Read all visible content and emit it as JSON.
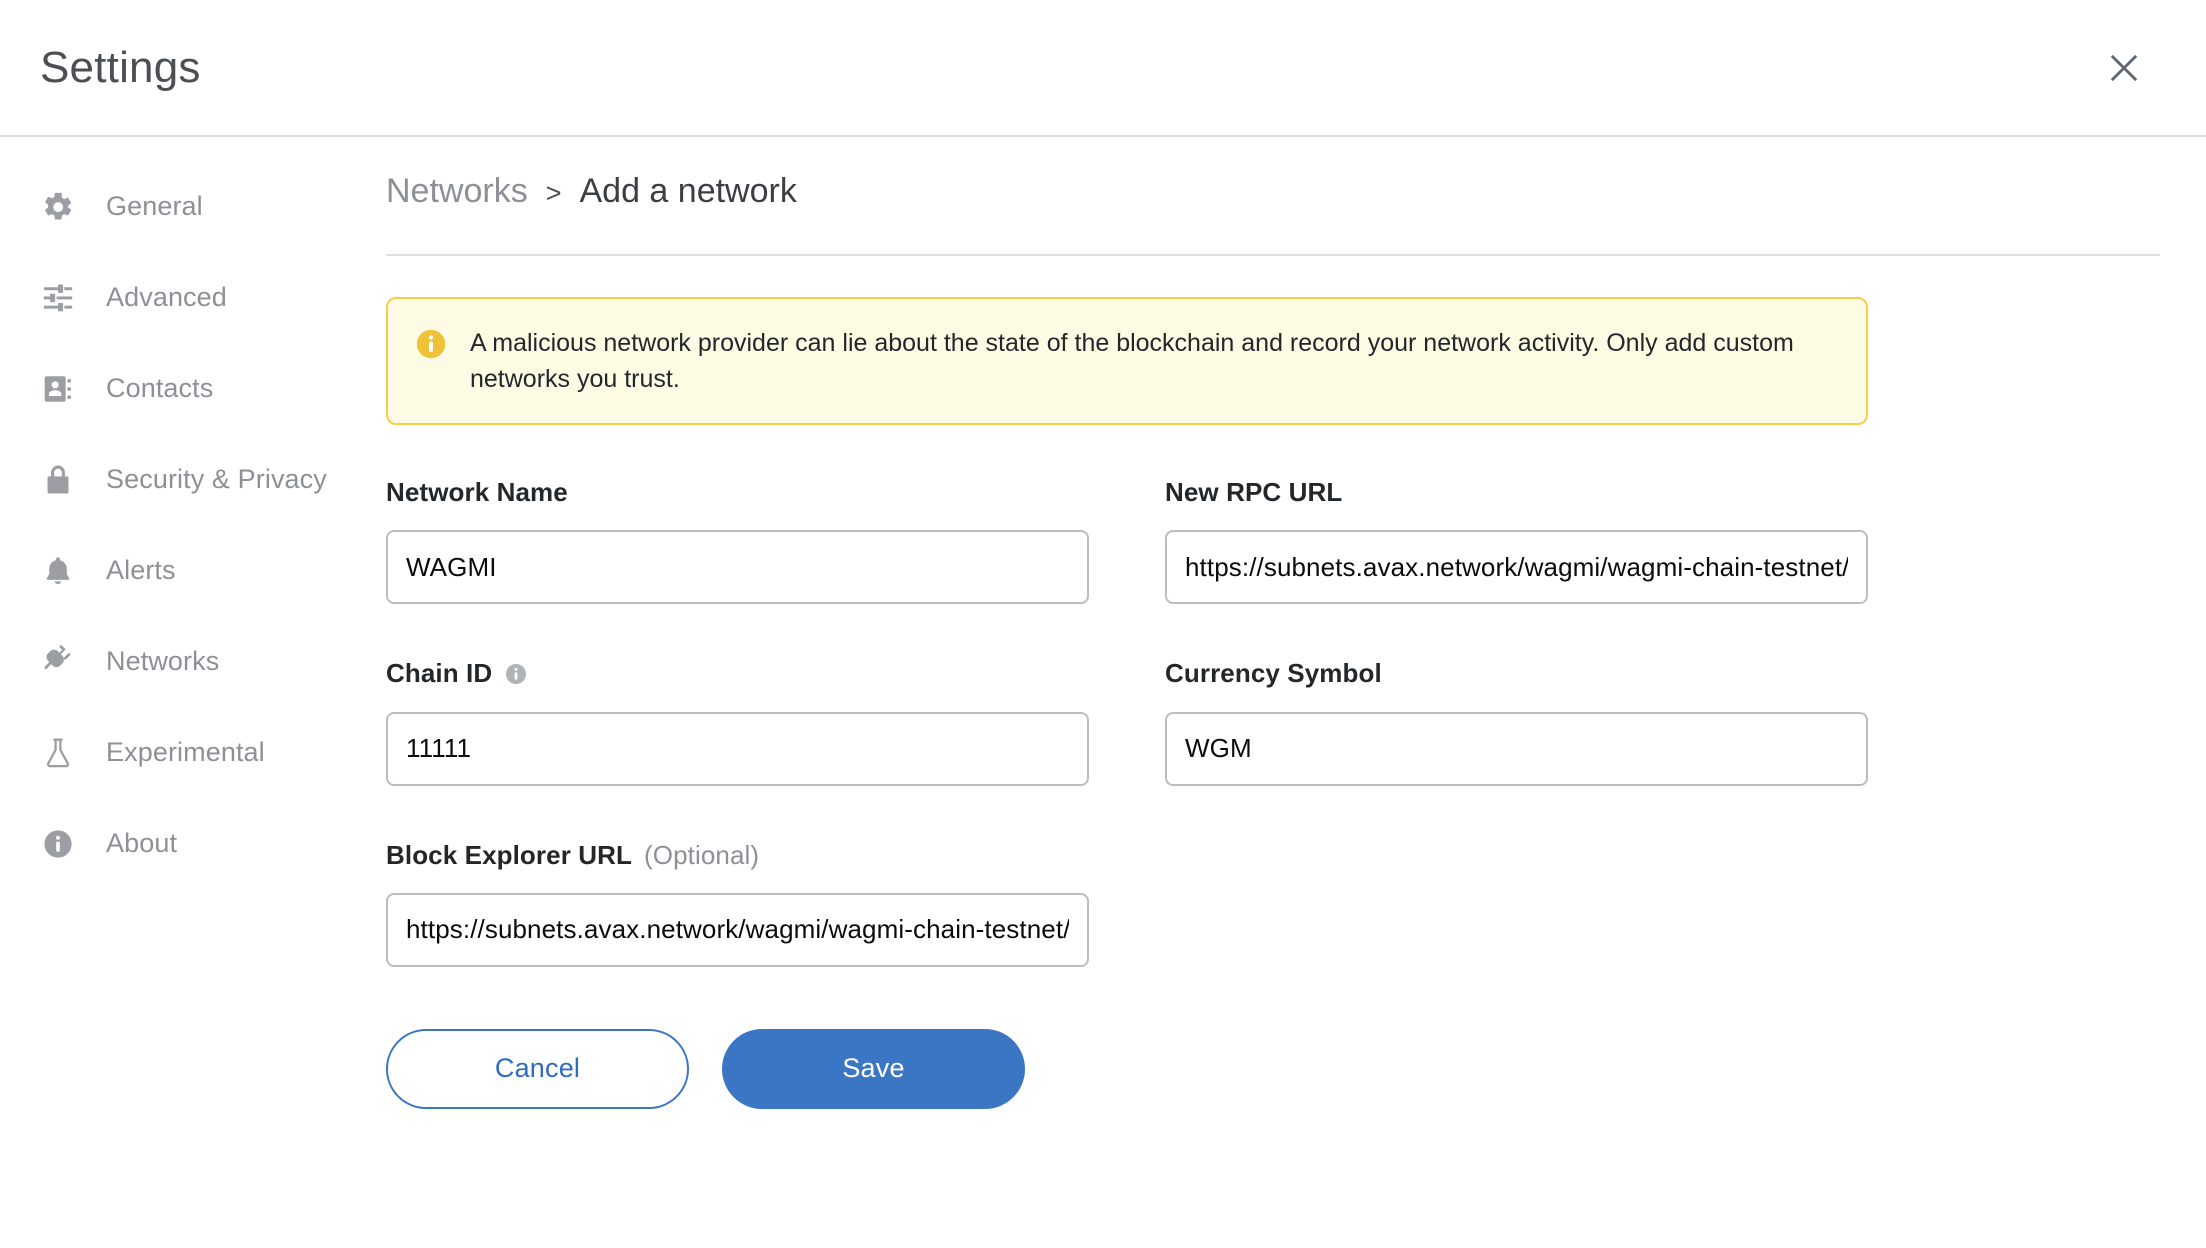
{
  "header": {
    "title": "Settings",
    "close_icon": "close-icon"
  },
  "sidebar": {
    "items": [
      {
        "label": "General",
        "icon": "gear-icon"
      },
      {
        "label": "Advanced",
        "icon": "sliders-icon"
      },
      {
        "label": "Contacts",
        "icon": "contact-book-icon"
      },
      {
        "label": "Security & Privacy",
        "icon": "lock-icon"
      },
      {
        "label": "Alerts",
        "icon": "bell-icon"
      },
      {
        "label": "Networks",
        "icon": "plug-icon"
      },
      {
        "label": "Experimental",
        "icon": "flask-icon"
      },
      {
        "label": "About",
        "icon": "info-circle-icon"
      }
    ]
  },
  "breadcrumb": {
    "parent": "Networks",
    "separator": ">",
    "current": "Add a network"
  },
  "banner": {
    "icon": "info-circle-icon",
    "text": "A malicious network provider can lie about the state of the blockchain and record your network activity. Only add custom networks you trust.",
    "background_color": "#fdfbe4",
    "border_color": "#f5cf4a",
    "icon_color": "#f0c237"
  },
  "form": {
    "network_name": {
      "label": "Network Name",
      "value": "WAGMI",
      "placeholder": ""
    },
    "rpc_url": {
      "label": "New RPC URL",
      "value": "https://subnets.avax.network/wagmi/wagmi-chain-testnet/rpc",
      "placeholder": ""
    },
    "chain_id": {
      "label": "Chain ID",
      "value": "11111",
      "placeholder": "",
      "info_icon": "info-circle-icon"
    },
    "currency_symbol": {
      "label": "Currency Symbol",
      "value": "WGM",
      "placeholder": ""
    },
    "block_explorer_url": {
      "label": "Block Explorer URL",
      "optional_note": "(Optional)",
      "value": "https://subnets.avax.network/wagmi/wagmi-chain-testnet/explorer",
      "placeholder": ""
    }
  },
  "actions": {
    "cancel_label": "Cancel",
    "save_label": "Save",
    "accent_color": "#3b76c4"
  }
}
